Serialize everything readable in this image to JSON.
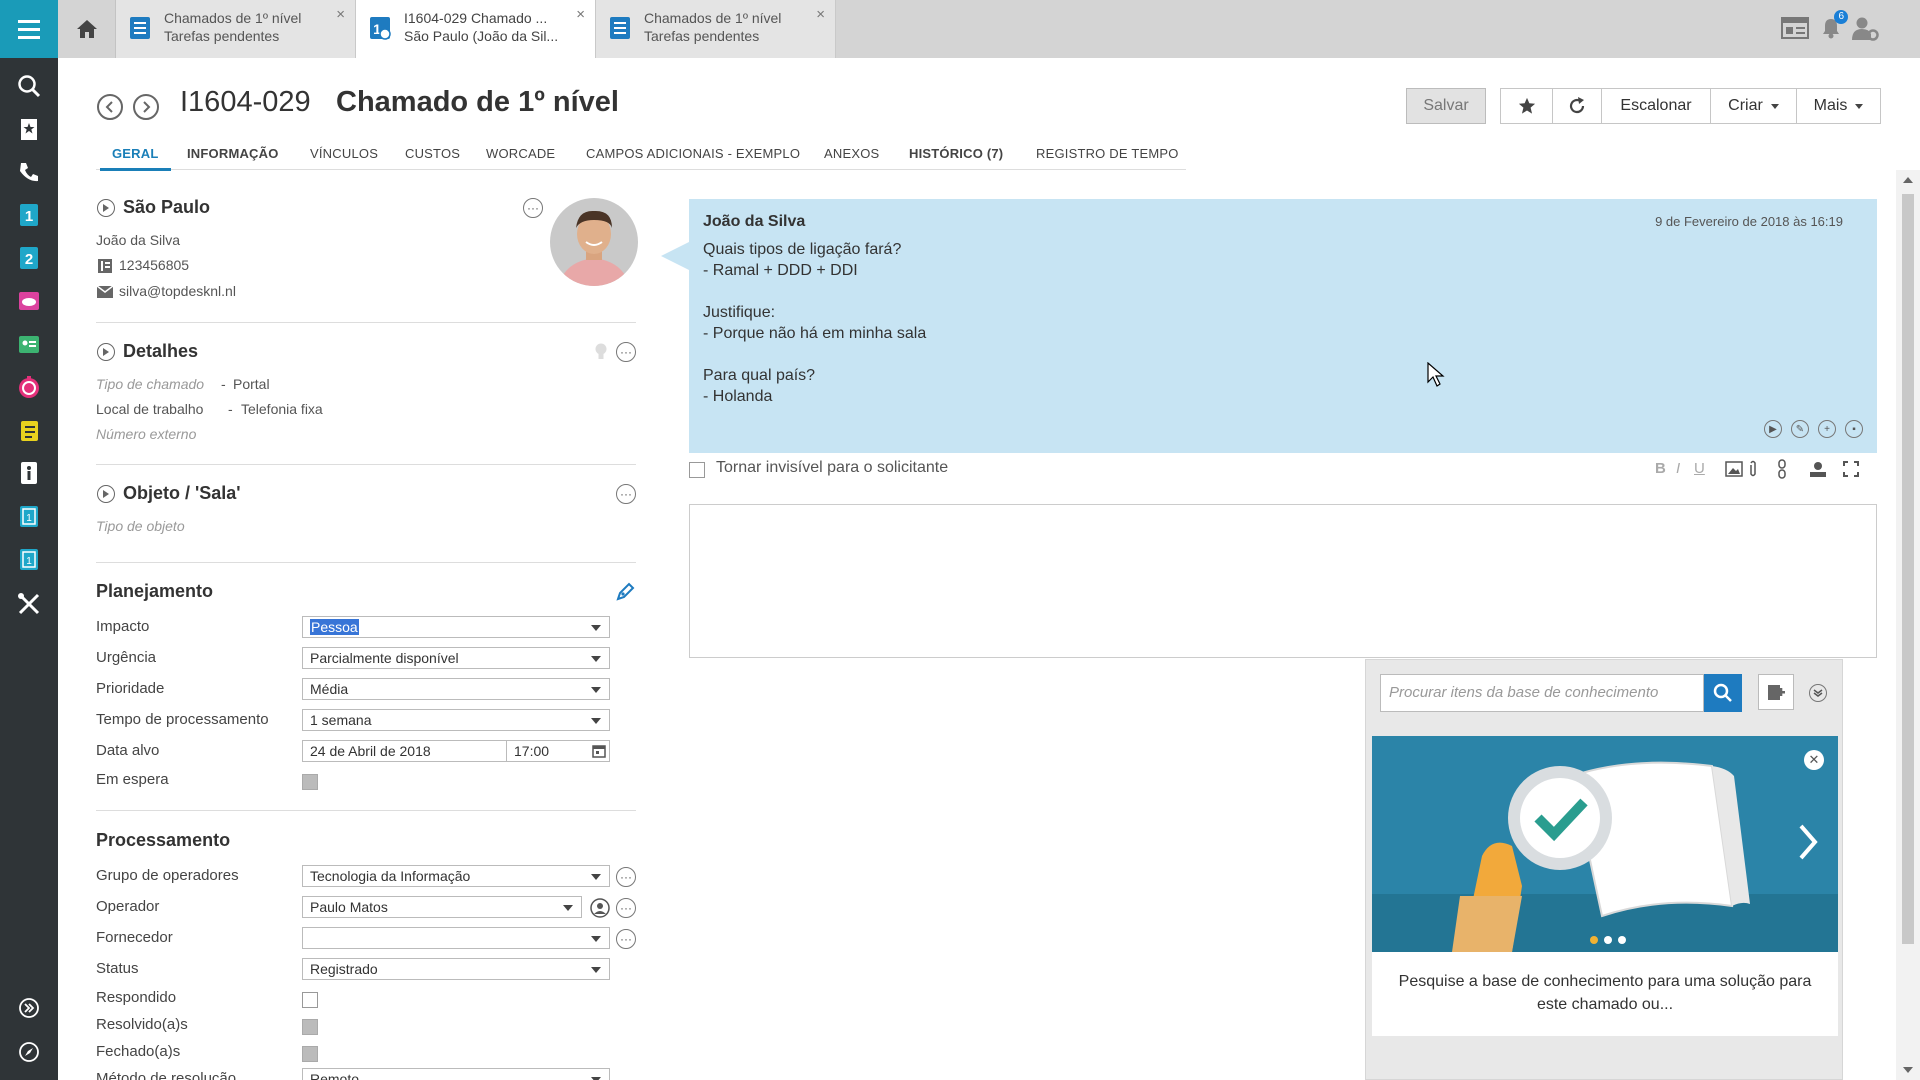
{
  "topbar": {
    "tabs": [
      {
        "line1": "Chamados de 1º nível",
        "line2": "Tarefas pendentes"
      },
      {
        "line1": "I1604-029 Chamado ...",
        "line2": "São Paulo (João da Sil..."
      },
      {
        "line1": "Chamados de 1º nível",
        "line2": "Tarefas pendentes"
      }
    ],
    "close_glyph": "×",
    "notification_count": "6"
  },
  "rail_icons": [
    "search-icon",
    "bookmark-icon",
    "phone-icon",
    "first-line-icon",
    "second-line-icon",
    "cloud-icon",
    "contract-icon",
    "timer-icon",
    "checklist-icon",
    "info-icon",
    "report-1-icon",
    "report-2-icon",
    "tools-icon",
    "expand-icon",
    "compass-icon"
  ],
  "header": {
    "record_id": "I1604-029",
    "title": "Chamado de 1º nível",
    "save_label": "Salvar",
    "escalate_label": "Escalonar",
    "create_label": "Criar",
    "more_label": "Mais"
  },
  "section_tabs": [
    "GERAL",
    "INFORMAÇÃO",
    "VÍNCULOS",
    "CUSTOS",
    "WORCADE",
    "CAMPOS ADICIONAIS - EXEMPLO",
    "ANEXOS",
    "HISTÓRICO (7)",
    "REGISTRO DE TEMPO"
  ],
  "caller": {
    "location": "São Paulo",
    "name": "João da Silva",
    "phone": "123456805",
    "email": "silva@topdesknl.nl"
  },
  "details": {
    "title": "Detalhes",
    "call_type_label": "Tipo de chamado",
    "call_type_value": "Portal",
    "workplace_label": "Local de trabalho",
    "workplace_value": "Telefonia fixa",
    "external_number_label": "Número externo",
    "separator": "-"
  },
  "object": {
    "title": "Objeto / 'Sala'",
    "object_type_label": "Tipo de objeto"
  },
  "planning": {
    "title": "Planejamento",
    "impact_label": "Impacto",
    "impact_value": "Pessoa",
    "urgency_label": "Urgência",
    "urgency_value": "Parcialmente disponível",
    "priority_label": "Prioridade",
    "priority_value": "Média",
    "duration_label": "Tempo de processamento",
    "duration_value": "1 semana",
    "target_label": "Data alvo",
    "target_date": "24 de Abril de 2018",
    "target_time": "17:00",
    "on_hold_label": "Em espera"
  },
  "processing": {
    "title": "Processamento",
    "group_label": "Grupo de operadores",
    "group_value": "Tecnologia da Informação",
    "operator_label": "Operador",
    "operator_value": "Paulo Matos",
    "supplier_label": "Fornecedor",
    "supplier_value": "",
    "status_label": "Status",
    "status_value": "Registrado",
    "responded_label": "Respondido",
    "resolved_label": "Resolvido(a)s",
    "closed_label": "Fechado(a)s",
    "method_label": "Método de resolução",
    "method_value": "Remoto"
  },
  "note": {
    "author": "João da Silva",
    "timestamp": "9 de Fevereiro de 2018 às 16:19",
    "lines": [
      "Quais tipos de ligação fará?",
      "- Ramal + DDD + DDI",
      "",
      "Justifique:",
      "- Porque não há em minha sala",
      "",
      "Para qual país?",
      "- Holanda"
    ]
  },
  "editor": {
    "invisible_label": "Tornar invisível para o solicitante",
    "bold": "B",
    "italic": "I",
    "underline": "U"
  },
  "kb": {
    "search_placeholder": "Procurar itens da base de conhecimento",
    "card_text": "Pesquise a base de conhecimento para uma solução para este chamado ou..."
  },
  "colors": {
    "rail": "#2f3437",
    "accent": "#1a9bb8",
    "note_bg": "#c7e4f3",
    "tab_active": "#1a7fb8",
    "kb_button": "#1e7bc0"
  }
}
